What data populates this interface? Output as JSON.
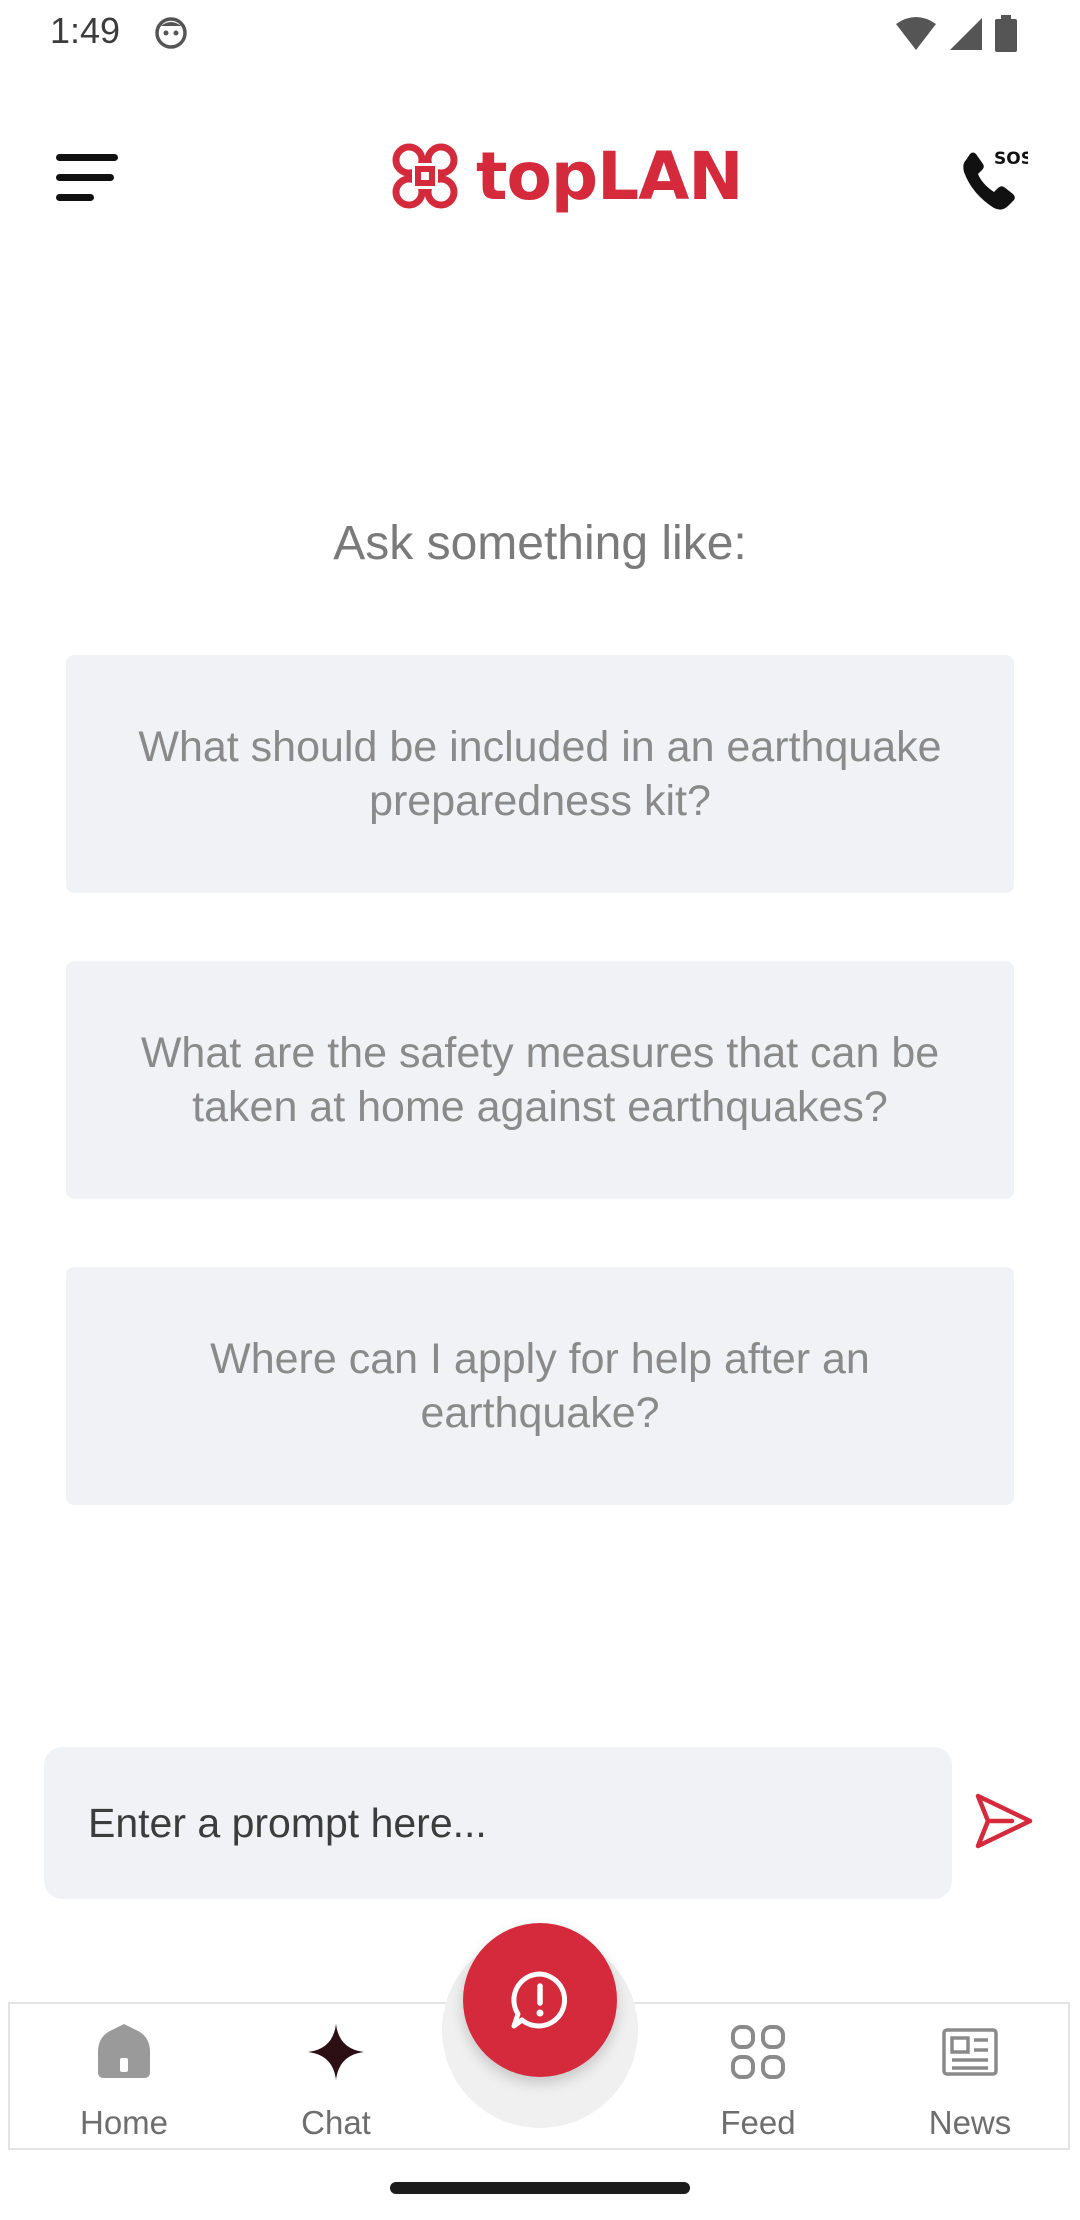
{
  "status_bar": {
    "time": "1:49"
  },
  "header": {
    "logo_text": "topLAN",
    "menu_icon": "menu-icon",
    "sos_icon": "sos-phone-icon",
    "sos_label": "SOS"
  },
  "main": {
    "ask_title": "Ask something like:",
    "suggestions": [
      "What should be included in an earthquake preparedness kit?",
      "What are the safety measures that can be taken at home against earthquakes?",
      "Where can I apply for help after an earthquake?"
    ]
  },
  "prompt": {
    "placeholder": "Enter a prompt here...",
    "value": ""
  },
  "bottom_nav": {
    "items": [
      {
        "label": "Home",
        "icon": "home-icon",
        "active": false
      },
      {
        "label": "Chat",
        "icon": "sparkle-icon",
        "active": true
      },
      {
        "label": "Feed",
        "icon": "grid-icon",
        "active": false
      },
      {
        "label": "News",
        "icon": "newspaper-icon",
        "active": false
      }
    ],
    "fab_icon": "alert-chat-icon"
  },
  "colors": {
    "brand": "#d42a3c",
    "card_bg": "#f1f2f6",
    "muted_text": "#8a8a8a"
  }
}
